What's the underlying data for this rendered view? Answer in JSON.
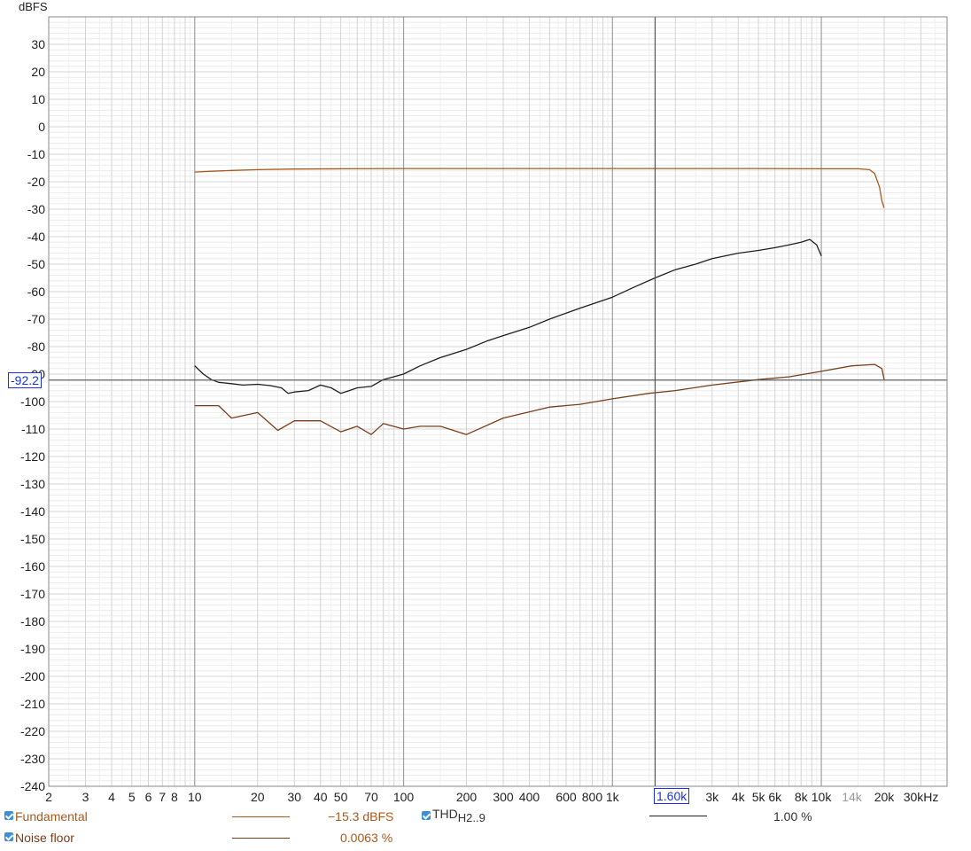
{
  "chart_data": {
    "type": "line",
    "ylabel": "dBFS",
    "xlabel": "",
    "x_scale": "log",
    "xlim": [
      2,
      40000
    ],
    "ylim": [
      -240,
      40
    ],
    "y_ticks": [
      30,
      20,
      10,
      0,
      -10,
      -20,
      -30,
      -40,
      -50,
      -60,
      -70,
      -80,
      -90,
      -100,
      -110,
      -120,
      -130,
      -140,
      -150,
      -160,
      -170,
      -180,
      -190,
      -200,
      -210,
      -220,
      -230,
      -240
    ],
    "x_tick_labels": [
      {
        "v": 2,
        "t": "2"
      },
      {
        "v": 3,
        "t": "3"
      },
      {
        "v": 4,
        "t": "4"
      },
      {
        "v": 5,
        "t": "5"
      },
      {
        "v": 6,
        "t": "6"
      },
      {
        "v": 7,
        "t": "7"
      },
      {
        "v": 8,
        "t": "8"
      },
      {
        "v": 10,
        "t": "10"
      },
      {
        "v": 20,
        "t": "20"
      },
      {
        "v": 30,
        "t": "30"
      },
      {
        "v": 40,
        "t": "40"
      },
      {
        "v": 50,
        "t": "50"
      },
      {
        "v": 70,
        "t": "70"
      },
      {
        "v": 100,
        "t": "100"
      },
      {
        "v": 200,
        "t": "200"
      },
      {
        "v": 300,
        "t": "300"
      },
      {
        "v": 400,
        "t": "400"
      },
      {
        "v": 600,
        "t": "600"
      },
      {
        "v": 800,
        "t": "800"
      },
      {
        "v": 1000,
        "t": "1k"
      },
      {
        "v": 2000,
        "t": "k"
      },
      {
        "v": 3000,
        "t": "3k"
      },
      {
        "v": 4000,
        "t": "4k"
      },
      {
        "v": 5000,
        "t": "5k"
      },
      {
        "v": 6000,
        "t": "6k"
      },
      {
        "v": 8000,
        "t": "8k"
      },
      {
        "v": 10000,
        "t": "10k"
      },
      {
        "v": 14000,
        "t": "14k",
        "muted": true
      },
      {
        "v": 20000,
        "t": "20k"
      },
      {
        "v": 30000,
        "t": "30kHz"
      }
    ],
    "grid": true,
    "cursor": {
      "x": 1600,
      "x_label": "1.60k",
      "y": -92.2,
      "y_label": "-92.2"
    },
    "series": [
      {
        "name": "Fundamental",
        "color": "#a9581c",
        "x": [
          10,
          12,
          15,
          20,
          30,
          50,
          100,
          200,
          500,
          1000,
          2000,
          5000,
          10000,
          15000,
          17000,
          18000,
          19000,
          19500,
          20000
        ],
        "y": [
          -16.5,
          -16.2,
          -15.9,
          -15.6,
          -15.4,
          -15.3,
          -15.2,
          -15.2,
          -15.2,
          -15.2,
          -15.2,
          -15.2,
          -15.3,
          -15.3,
          -15.6,
          -17,
          -22,
          -27,
          -29.5
        ]
      },
      {
        "name": "THD H2..9",
        "color": "#1f1f1f",
        "x": [
          10,
          11,
          12,
          13,
          15,
          17,
          20,
          23,
          26,
          28,
          30,
          35,
          40,
          45,
          50,
          55,
          60,
          70,
          80,
          100,
          120,
          150,
          200,
          250,
          300,
          400,
          500,
          700,
          1000,
          1300,
          1600,
          2000,
          2500,
          3000,
          4000,
          5000,
          6000,
          7000,
          8000,
          8800,
          9500,
          10000
        ],
        "y": [
          -87,
          -90,
          -92,
          -93,
          -93.5,
          -94,
          -93.7,
          -94.2,
          -95,
          -97,
          -96.5,
          -96,
          -94,
          -95,
          -97,
          -96,
          -95,
          -94.5,
          -92,
          -90,
          -87,
          -84,
          -81,
          -78,
          -76,
          -73,
          -70,
          -66,
          -62,
          -58,
          -55,
          -52,
          -50,
          -48,
          -46,
          -45,
          -44,
          -43,
          -42,
          -41,
          -43,
          -47
        ]
      },
      {
        "name": "Noise floor",
        "color": "#7a3e1a",
        "x": [
          10,
          13,
          15,
          20,
          25,
          30,
          40,
          50,
          60,
          70,
          80,
          100,
          120,
          150,
          200,
          300,
          500,
          700,
          1000,
          1500,
          2000,
          3000,
          5000,
          7000,
          10000,
          14000,
          18000,
          19500,
          20000
        ],
        "y": [
          -101.5,
          -101.5,
          -106,
          -104,
          -110.5,
          -107,
          -107,
          -111,
          -109,
          -112,
          -108,
          -110,
          -109,
          -109,
          -112,
          -106,
          -102,
          -101,
          -99,
          -97,
          -96,
          -94,
          -92,
          -91,
          -89,
          -87,
          -86.5,
          -88,
          -92
        ]
      }
    ]
  },
  "legend": {
    "fundamental_label": "Fundamental",
    "fundamental_value": "−15.3 dBFS",
    "thd_label": "THD",
    "thd_sub": "H2..9",
    "thd_value": "1.00 %",
    "noise_label": "Noise floor",
    "noise_value": "0.0063 %"
  }
}
